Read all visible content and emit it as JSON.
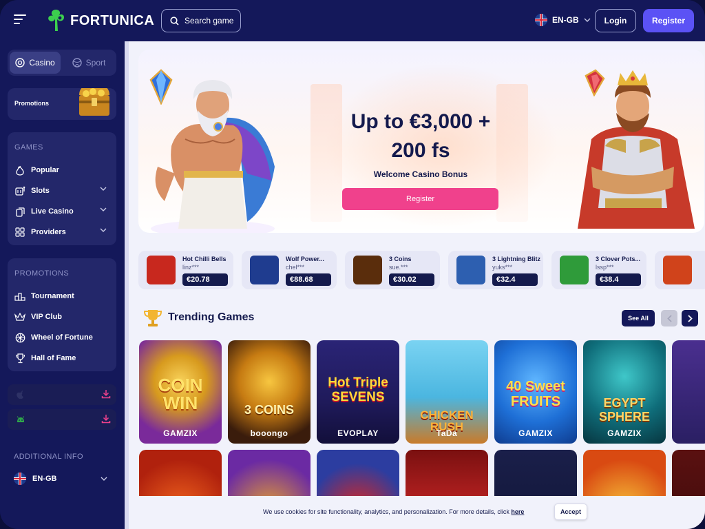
{
  "header": {
    "logo_text": "FORTUNICA",
    "search_label": "Search game",
    "lang_label": "EN-GB",
    "login_label": "Login",
    "register_label": "Register"
  },
  "sidebar": {
    "tabs": [
      {
        "label": "Casino",
        "active": true
      },
      {
        "label": "Sport",
        "active": false
      }
    ],
    "promotions_card_label": "Promotions",
    "games_title": "GAMES",
    "games_items": [
      {
        "label": "Popular",
        "icon": "flame-icon",
        "expandable": false
      },
      {
        "label": "Slots",
        "icon": "slot-machine-icon",
        "expandable": true
      },
      {
        "label": "Live Casino",
        "icon": "cards-icon",
        "expandable": true
      },
      {
        "label": "Providers",
        "icon": "grid-icon",
        "expandable": true
      }
    ],
    "promotions_title": "PROMOTIONS",
    "promotions_items": [
      {
        "label": "Tournament",
        "icon": "podium-icon"
      },
      {
        "label": "VIP Club",
        "icon": "crown-icon"
      },
      {
        "label": "Wheel of Fortune",
        "icon": "wheel-icon"
      },
      {
        "label": "Hall of Fame",
        "icon": "trophy-icon"
      }
    ],
    "additional_title": "ADDITIONAL INFO",
    "additional_lang": "EN-GB"
  },
  "hero": {
    "title_line1": "Up to €3,000 +",
    "title_line2": "200 fs",
    "subtitle": "Welcome Casino Bonus",
    "button_label": "Register"
  },
  "winners": [
    {
      "game": "Hot Chilli Bells",
      "user": "linz***",
      "amount": "€20.78",
      "thumb": "#c8281e"
    },
    {
      "game": "Wolf Power...",
      "user": "chel***",
      "amount": "€88.68",
      "thumb": "#1f3c8f"
    },
    {
      "game": "3 Coins",
      "user": "sue.***",
      "amount": "€30.02",
      "thumb": "#5a2d0c"
    },
    {
      "game": "3 Lightning Blitz",
      "user": "yuks***",
      "amount": "€32.4",
      "thumb": "#2d5fb0"
    },
    {
      "game": "3 Clover Pots...",
      "user": "lssp***",
      "amount": "€38.4",
      "thumb": "#2f9b3a"
    },
    {
      "game": "",
      "user": "",
      "amount": "",
      "thumb": "#d0431b"
    }
  ],
  "trending": {
    "title": "Trending Games",
    "see_all_label": "See All"
  },
  "games_row1": [
    {
      "title": "COIN WIN",
      "provider": "GAMZIX",
      "bg": "#7a2a9a",
      "accent": "#f5c234"
    },
    {
      "title": "3 COINS",
      "provider": "booongo",
      "bg": "#3a1c0c",
      "accent": "#f3b526"
    },
    {
      "title": "Hot Triple SEVENS",
      "provider": "EVOPLAY",
      "bg": "#1f1a5a",
      "accent": "#f7d026"
    },
    {
      "title": "CHICKEN RUSH",
      "provider": "TaDa",
      "bg": "#4bb6e0",
      "accent": "#f09a2b"
    },
    {
      "title": "40 Sweet FRUITS",
      "provider": "GAMZIX",
      "bg": "#1e6fd6",
      "accent": "#e9479a"
    },
    {
      "title": "EGYPT SPHERE",
      "provider": "GAMZIX",
      "bg": "#0f6d7a",
      "accent": "#f3c04a"
    },
    {
      "title": "",
      "provider": "",
      "bg": "#2a1f63",
      "accent": "#f5c234"
    }
  ],
  "games_row2": [
    {
      "bg": "#b0210d"
    },
    {
      "bg": "#6b2aa3"
    },
    {
      "bg": "#2c3da0"
    },
    {
      "bg": "#a81d1d"
    },
    {
      "bg": "#101434"
    },
    {
      "bg": "#d94a12"
    },
    {
      "bg": "#3c0c0c"
    }
  ],
  "cookie": {
    "text": "We use cookies for site functionality, analytics, and personalization. For more details, click",
    "link_label": "here",
    "accept_label": "Accept"
  }
}
